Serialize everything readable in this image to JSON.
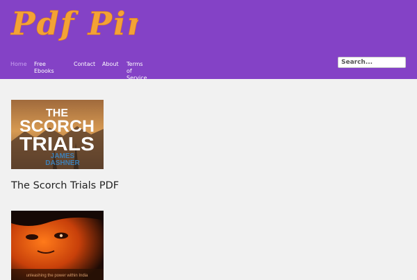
{
  "site": {
    "logo_text": "Pdf Pimp"
  },
  "nav": {
    "items": [
      {
        "label_line1": "Home",
        "label_line2": ""
      },
      {
        "label_line1": "Free",
        "label_line2": "Ebooks"
      },
      {
        "label_line1": "Contact",
        "label_line2": ""
      },
      {
        "label_line1": "About",
        "label_line2": ""
      },
      {
        "label_line1": "Terms of",
        "label_line2": "Service"
      }
    ]
  },
  "search": {
    "placeholder": "Search..."
  },
  "posts": [
    {
      "cover_title_line1": "THE",
      "cover_title_line2": "SCORCH",
      "cover_title_line3": "TRIALS",
      "cover_author_line1": "JAMES",
      "cover_author_line2": "DASHNER",
      "title": "The Scorch Trials PDF"
    },
    {
      "cover_caption": "unleashing the power within India",
      "title": ""
    }
  ],
  "colors": {
    "header_bg": "#8442c6",
    "logo_fill": "#f3a236",
    "nav_active": "#c8a2f0",
    "page_bg": "#f1f1f1"
  }
}
